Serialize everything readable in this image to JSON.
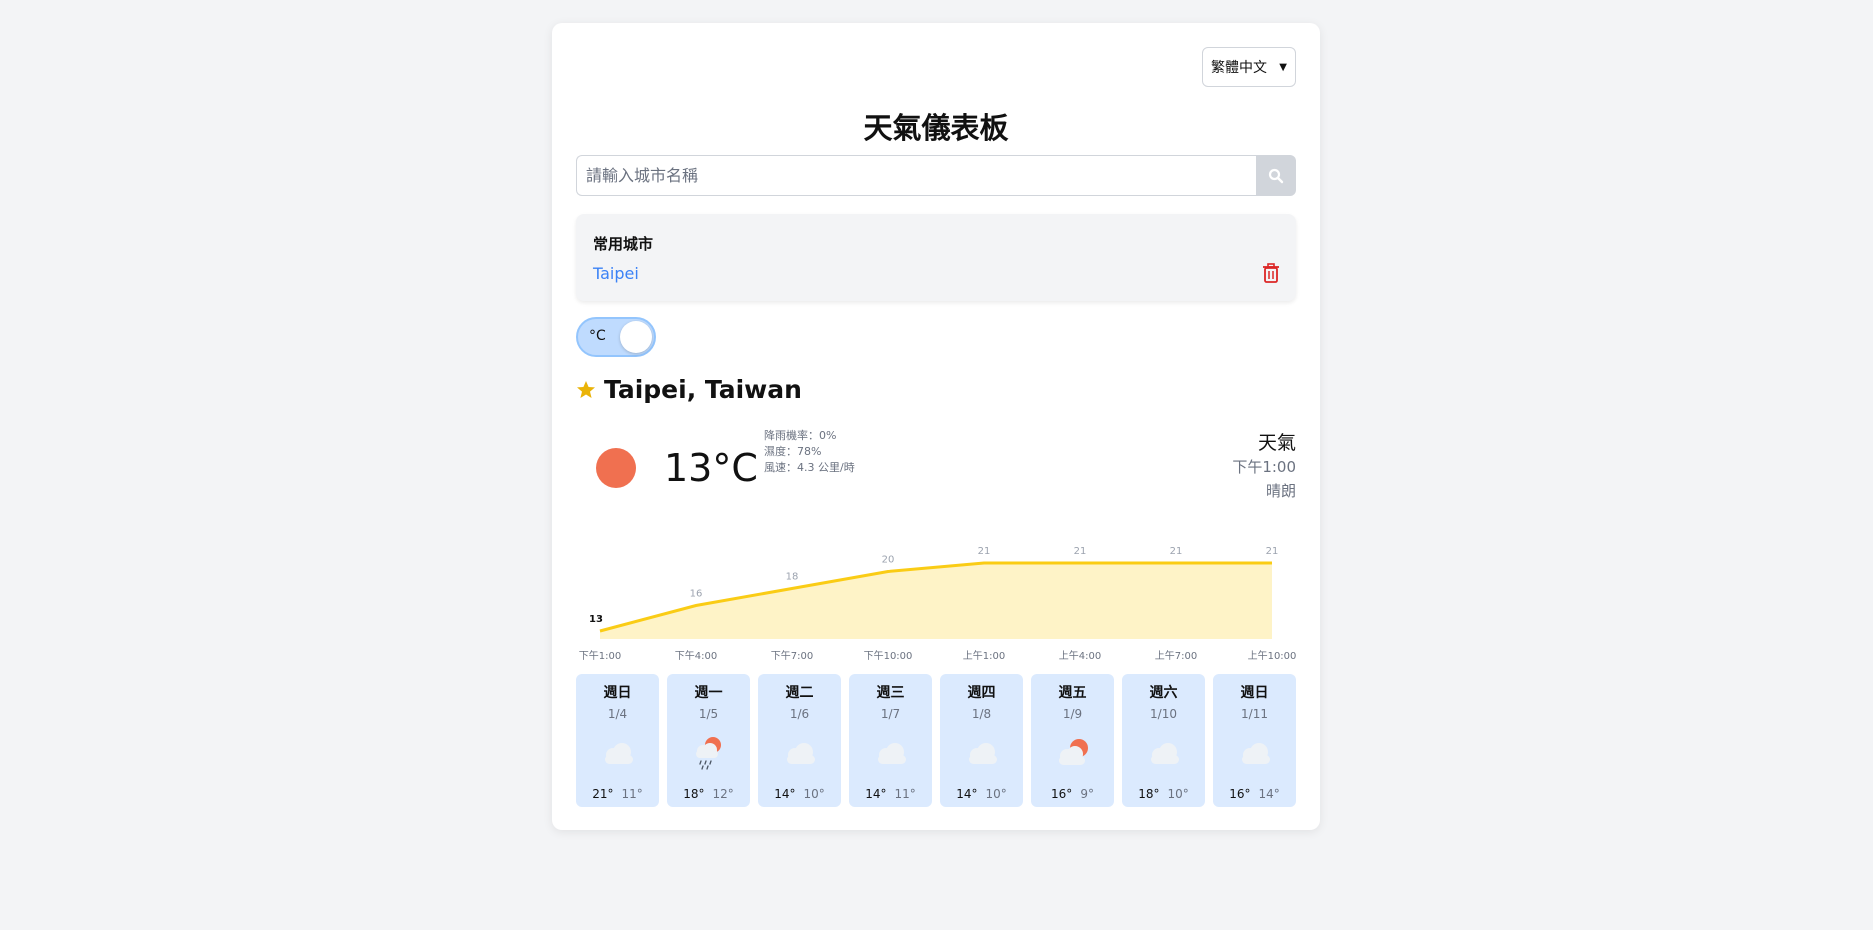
{
  "language": {
    "selected": "繁體中文"
  },
  "app": {
    "title": "天氣儀表板"
  },
  "search": {
    "placeholder": "請輸入城市名稱"
  },
  "favorites": {
    "title": "常用城市",
    "cities": [
      "Taipei"
    ]
  },
  "unit_toggle": {
    "label": "°C"
  },
  "location": {
    "name": "Taipei, Taiwan"
  },
  "current": {
    "temp": "13°C",
    "rain": "降雨機率：0%",
    "humidity": "濕度：78%",
    "wind": "風速：4.3 公里/時",
    "label": "天氣",
    "time": "下午1:00",
    "condition": "晴朗"
  },
  "chart_data": {
    "type": "area",
    "categories": [
      "下午1:00",
      "下午4:00",
      "下午7:00",
      "下午10:00",
      "上午1:00",
      "上午4:00",
      "上午7:00",
      "上午10:00"
    ],
    "values": [
      13,
      16,
      18,
      20,
      21,
      21,
      21,
      21
    ],
    "ylim": [
      10,
      22
    ],
    "color": "#facc15",
    "fill": "#fef3c7"
  },
  "forecast": [
    {
      "day": "週日",
      "date": "1/4",
      "icon": "cloud-icon",
      "hi": "21°",
      "lo": "11°"
    },
    {
      "day": "週一",
      "date": "1/5",
      "icon": "sun-rain-cloud-icon",
      "hi": "18°",
      "lo": "12°"
    },
    {
      "day": "週二",
      "date": "1/6",
      "icon": "cloud-icon",
      "hi": "14°",
      "lo": "10°"
    },
    {
      "day": "週三",
      "date": "1/7",
      "icon": "cloud-icon",
      "hi": "14°",
      "lo": "11°"
    },
    {
      "day": "週四",
      "date": "1/8",
      "icon": "cloud-icon",
      "hi": "14°",
      "lo": "10°"
    },
    {
      "day": "週五",
      "date": "1/9",
      "icon": "sun-cloud-icon",
      "hi": "16°",
      "lo": "9°"
    },
    {
      "day": "週六",
      "date": "1/10",
      "icon": "cloud-icon",
      "hi": "18°",
      "lo": "10°"
    },
    {
      "day": "週日",
      "date": "1/11",
      "icon": "cloud-icon",
      "hi": "16°",
      "lo": "14°"
    }
  ]
}
